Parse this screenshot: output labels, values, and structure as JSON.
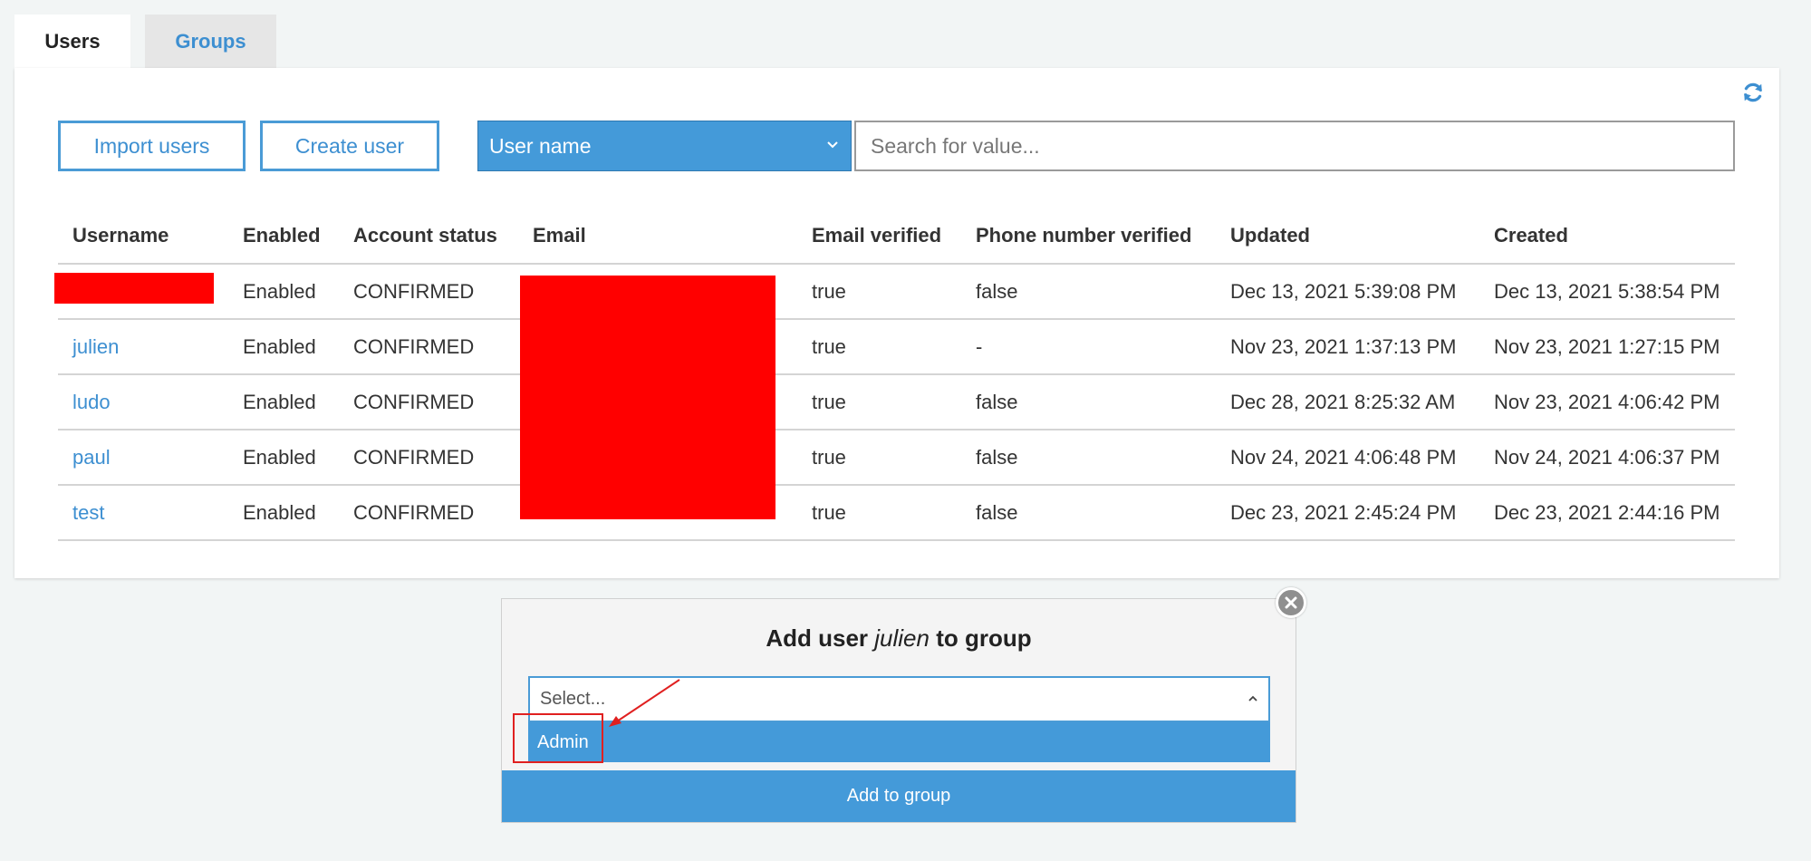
{
  "tabs": [
    {
      "label": "Users",
      "active": true
    },
    {
      "label": "Groups",
      "active": false
    }
  ],
  "toolbar": {
    "import_label": "Import users",
    "create_label": "Create user",
    "filter_attribute": "User name",
    "search_placeholder": "Search for value..."
  },
  "table": {
    "headers": [
      "Username",
      "Enabled",
      "Account status",
      "Email",
      "Email verified",
      "Phone number verified",
      "Updated",
      "Created"
    ],
    "rows": [
      {
        "username": "",
        "enabled": "Enabled",
        "status": "CONFIRMED",
        "email": "",
        "email_verified": "true",
        "phone_verified": "false",
        "updated": "Dec 13, 2021 5:39:08 PM",
        "created": "Dec 13, 2021 5:38:54 PM"
      },
      {
        "username": "julien",
        "enabled": "Enabled",
        "status": "CONFIRMED",
        "email": "",
        "email_verified": "true",
        "phone_verified": "-",
        "updated": "Nov 23, 2021 1:37:13 PM",
        "created": "Nov 23, 2021 1:27:15 PM"
      },
      {
        "username": "ludo",
        "enabled": "Enabled",
        "status": "CONFIRMED",
        "email": "",
        "email_verified": "true",
        "phone_verified": "false",
        "updated": "Dec 28, 2021 8:25:32 AM",
        "created": "Nov 23, 2021 4:06:42 PM"
      },
      {
        "username": "paul",
        "enabled": "Enabled",
        "status": "CONFIRMED",
        "email": "",
        "email_verified": "true",
        "phone_verified": "false",
        "updated": "Nov 24, 2021 4:06:48 PM",
        "created": "Nov 24, 2021 4:06:37 PM"
      },
      {
        "username": "test",
        "enabled": "Enabled",
        "status": "CONFIRMED",
        "email": "",
        "email_verified": "true",
        "phone_verified": "false",
        "updated": "Dec 23, 2021 2:45:24 PM",
        "created": "Dec 23, 2021 2:44:16 PM"
      }
    ]
  },
  "modal": {
    "title_prefix": "Add user",
    "title_user": "julien",
    "title_suffix": "to group",
    "select_placeholder": "Select...",
    "option": "Admin",
    "add_label": "Add to group"
  },
  "colors": {
    "accent": "#449ad9",
    "link": "#3d8fd1",
    "redaction": "#ff0000",
    "annotation": "#e02020"
  },
  "icons": [
    "refresh-icon",
    "chevron-down-icon",
    "chevron-up-icon",
    "close-icon"
  ]
}
